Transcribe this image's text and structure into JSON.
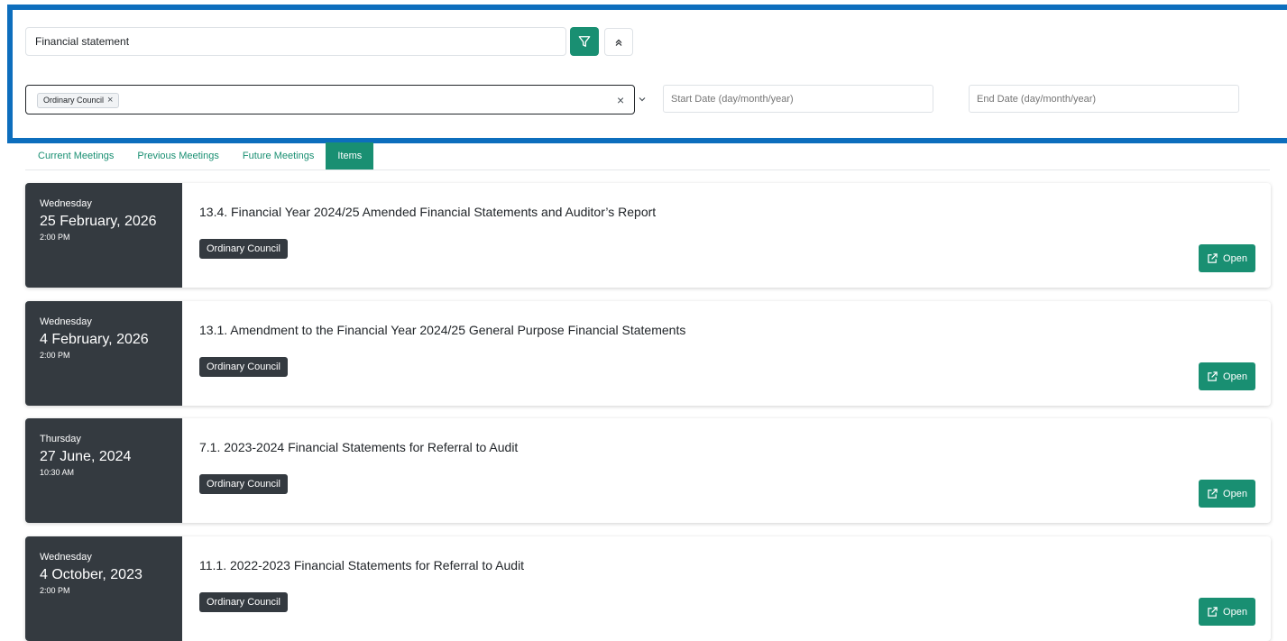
{
  "filters": {
    "search_value": "Financial statement",
    "selected_type": "Ordinary Council",
    "start_date_placeholder": "Start Date (day/month/year)",
    "end_date_placeholder": "End Date (day/month/year)"
  },
  "tabs": [
    {
      "label": "Current Meetings",
      "active": false
    },
    {
      "label": "Previous Meetings",
      "active": false
    },
    {
      "label": "Future Meetings",
      "active": false
    },
    {
      "label": "Items",
      "active": true
    }
  ],
  "items": [
    {
      "day": "Wednesday",
      "date": "25 February, 2026",
      "time": "2:00 PM",
      "title": "13.4. Financial Year 2024/25 Amended Financial Statements and Auditor’s Report",
      "badge": "Ordinary Council",
      "open_label": "Open"
    },
    {
      "day": "Wednesday",
      "date": "4 February, 2026",
      "time": "2:00 PM",
      "title": "13.1. Amendment to the Financial Year 2024/25 General Purpose Financial Statements",
      "badge": "Ordinary Council",
      "open_label": "Open"
    },
    {
      "day": "Thursday",
      "date": "27 June, 2024",
      "time": "10:30 AM",
      "title": "7.1. 2023-2024 Financial Statements for Referral to Audit",
      "badge": "Ordinary Council",
      "open_label": "Open"
    },
    {
      "day": "Wednesday",
      "date": "4 October, 2023",
      "time": "2:00 PM",
      "title": "11.1. 2022-2023 Financial Statements for Referral to Audit",
      "badge": "Ordinary Council",
      "open_label": "Open"
    }
  ],
  "colors": {
    "accent": "#198f72",
    "panel_border": "#0d6ebd",
    "date_bg": "#343a40"
  },
  "icons": {
    "filter": "filter-icon",
    "collapse": "double-chevron-up-icon",
    "clear": "close-icon",
    "dropdown": "chevron-down-icon",
    "open": "external-link-icon"
  }
}
